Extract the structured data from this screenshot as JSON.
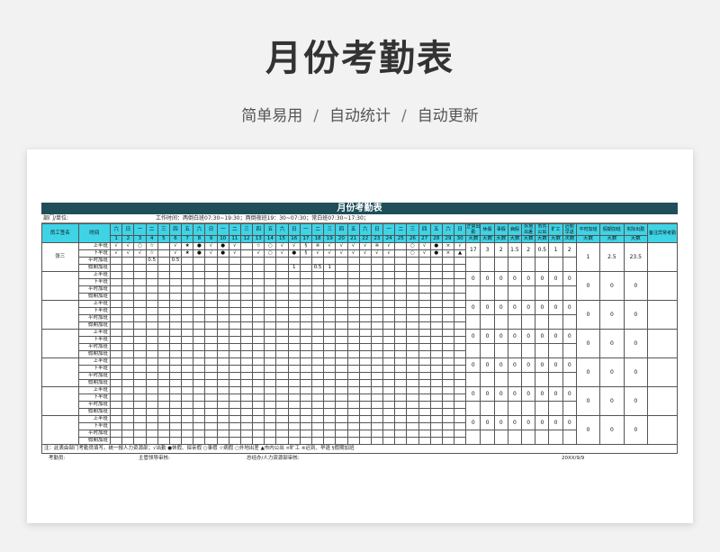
{
  "hero": {
    "title": "月份考勤表",
    "subtitle_parts": [
      "简单易用",
      "自动统计",
      "自动更新"
    ],
    "separator": "/"
  },
  "sheet": {
    "title": "月份考勤表",
    "dept_label": "部门/单位:",
    "work_time": "工作时间：两倒白班07:30~19:30；两倒夜班19：30~07:30；常白班07:30~17:30；",
    "header": {
      "name": "员工签名",
      "time": "时间",
      "weekdays": [
        "六",
        "日",
        "一",
        "二",
        "三",
        "四",
        "五",
        "六",
        "日",
        "一",
        "二",
        "三",
        "四",
        "五",
        "六",
        "日",
        "一",
        "二",
        "三",
        "四",
        "五",
        "六",
        "日",
        "一",
        "二",
        "三",
        "四",
        "五",
        "六",
        "日"
      ],
      "days": [
        "1",
        "2",
        "3",
        "4",
        "5",
        "6",
        "7",
        "8",
        "9",
        "10",
        "11",
        "12",
        "13",
        "14",
        "15",
        "16",
        "17",
        "18",
        "19",
        "20",
        "21",
        "22",
        "23",
        "24",
        "25",
        "26",
        "27",
        "28",
        "29",
        "30"
      ],
      "sum_cols": [
        {
          "top": "正常出勤",
          "bot": "天数"
        },
        {
          "top": "休假",
          "bot": "天数"
        },
        {
          "top": "事假",
          "bot": "天数"
        },
        {
          "top": "病假",
          "bot": "天数"
        },
        {
          "top": "外地出差",
          "bot": "天数"
        },
        {
          "top": "市内公出",
          "bot": "天数"
        },
        {
          "top": "旷工",
          "bot": "天数"
        },
        {
          "top": "迟到早退",
          "bot": "次数"
        },
        {
          "top": "平时加班",
          "bot": "天数"
        },
        {
          "top": "假期加班",
          "bot": "天数"
        },
        {
          "top": "实际出勤",
          "bot": "天数"
        },
        {
          "top": "备注异常考勤",
          "bot": ""
        }
      ]
    },
    "row_labels": [
      "上半班",
      "下半班",
      "平时加班",
      "假期加班"
    ],
    "employees": [
      {
        "name": "张三",
        "rows": [
          [
            "√",
            "√",
            "○",
            "☆",
            "",
            "√",
            "★",
            "●",
            "√",
            "●",
            "√",
            "",
            "☆",
            "○",
            "√",
            "√",
            "§",
            "※",
            "√",
            "√",
            "√",
            "√",
            "※",
            "√",
            "",
            "○",
            "√",
            "●",
            "×",
            "√"
          ],
          [
            "√",
            "√",
            "√",
            "☆",
            "",
            "√",
            "★",
            "●",
            "√",
            "●",
            "√",
            "",
            "√",
            "○",
            "√",
            "●",
            "§",
            "√",
            "√",
            "√",
            "√",
            "√",
            "√",
            "√",
            "",
            "○",
            "√",
            "●",
            "×",
            "▲"
          ],
          [
            "",
            "",
            "",
            "0.5",
            "",
            "0.5",
            "",
            "",
            "",
            "",
            "",
            "",
            "",
            "",
            "",
            "",
            "",
            "",
            "",
            "",
            "",
            "",
            "",
            "",
            "",
            "",
            "",
            "",
            "",
            ""
          ],
          [
            "",
            "",
            "",
            "",
            "",
            "",
            "",
            "",
            "",
            "",
            "",
            "",
            "",
            "",
            "",
            "1",
            "",
            "0.5",
            "1",
            "",
            "",
            "",
            "",
            "",
            "",
            "",
            "",
            "",
            "",
            ""
          ]
        ],
        "sums": [
          "17",
          "3",
          "2",
          "1.5",
          "2",
          "0.5",
          "1",
          "2",
          "1",
          "2.5",
          "23.5",
          ""
        ]
      },
      {
        "name": "",
        "rows": [],
        "sums": [
          "0",
          "0",
          "0",
          "0",
          "0",
          "0",
          "0",
          "0",
          "0",
          "0",
          "0",
          ""
        ]
      },
      {
        "name": "",
        "rows": [],
        "sums": [
          "0",
          "0",
          "0",
          "0",
          "0",
          "0",
          "0",
          "0",
          "0",
          "0",
          "0",
          ""
        ]
      },
      {
        "name": "",
        "rows": [],
        "sums": [
          "0",
          "0",
          "0",
          "0",
          "0",
          "0",
          "0",
          "0",
          "0",
          "0",
          "0",
          ""
        ]
      },
      {
        "name": "",
        "rows": [],
        "sums": [
          "0",
          "0",
          "0",
          "0",
          "0",
          "0",
          "0",
          "0",
          "0",
          "0",
          "0",
          ""
        ]
      },
      {
        "name": "",
        "rows": [],
        "sums": [
          "0",
          "0",
          "0",
          "0",
          "0",
          "0",
          "0",
          "0",
          "0",
          "0",
          "0",
          ""
        ]
      },
      {
        "name": "",
        "rows": [],
        "sums": [
          "0",
          "0",
          "0",
          "0",
          "0",
          "0",
          "0",
          "0",
          "0",
          "0",
          "0",
          ""
        ]
      }
    ],
    "note": "注：此表由部门考勤员填写。统一报人力资源部；√出勤 ●休假、探亲假 ○事假 ☆病假 ○外地出差 ▲市内公出 ×旷工 ※迟到、早退 §假期加班",
    "sign": {
      "clerk": "考勤员:",
      "supervisor": "主管领导审核:",
      "hr": "总经办/人力资源部审核:",
      "date": "20XX/9/9"
    }
  }
}
